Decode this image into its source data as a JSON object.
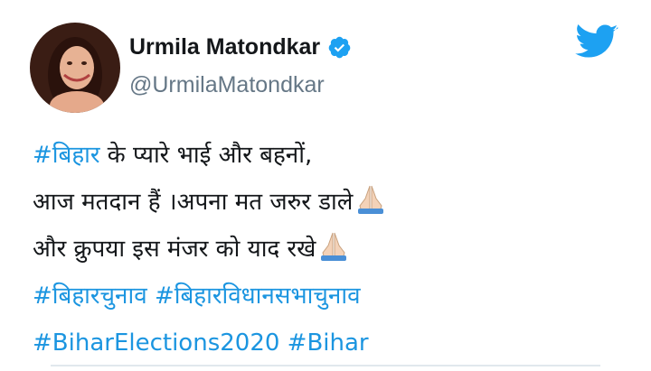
{
  "tweet": {
    "author": {
      "name": "Urmila Matondkar",
      "handle": "@UrmilaMatondkar",
      "verified": true
    },
    "lines": [
      {
        "hashtag": "#बिहार",
        "text": " के प्यारे भाई और बहनों,"
      },
      {
        "text": "आज मतदान हैं ।अपना मत जरुर डाले",
        "emoji": "folded-hands"
      },
      {
        "text": "और क्रुपया इस मंजर को याद रखे",
        "emoji": "folded-hands"
      }
    ],
    "hashtags_line1": [
      "#बिहारचुनाव",
      "#बिहारविधानसभाचुनाव"
    ],
    "hashtags_line2": [
      "#BiharElections2020",
      "#Bihar"
    ]
  },
  "colors": {
    "hashtag": "#1b95e0",
    "verified": "#1da1f2",
    "twitter_logo": "#1da1f2",
    "handle": "#657786"
  },
  "icons": [
    "verified-badge-icon",
    "twitter-bird-icon",
    "folded-hands-icon"
  ]
}
